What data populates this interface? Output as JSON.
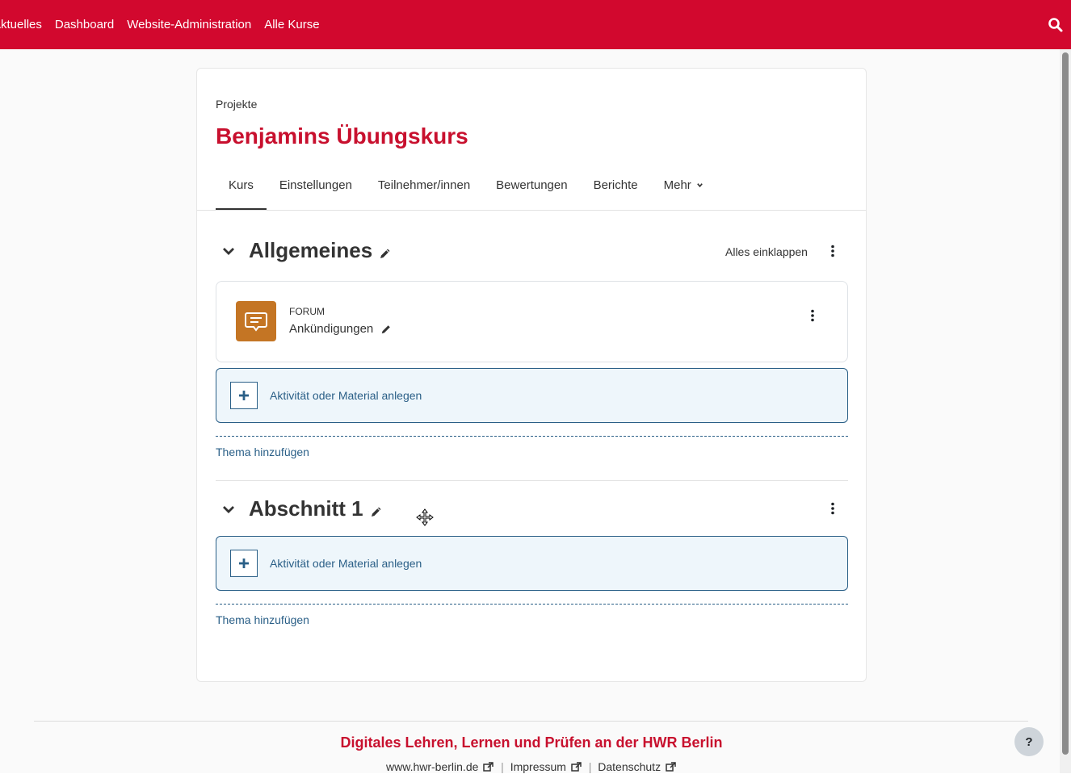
{
  "topnav": {
    "items": [
      "Aktuelles",
      "Dashboard",
      "Website-Administration",
      "Alle Kurse"
    ],
    "search_icon": "search-icon"
  },
  "course": {
    "breadcrumb": "Projekte",
    "title": "Benjamins Übungskurs",
    "tabs": [
      "Kurs",
      "Einstellungen",
      "Teilnehmer/innen",
      "Bewertungen",
      "Berichte",
      "Mehr"
    ],
    "active_tab": "Kurs"
  },
  "sections": [
    {
      "title": "Allgemeines",
      "collapse_all": "Alles einklappen",
      "activities": [
        {
          "type": "FORUM",
          "name": "Ankündigungen",
          "icon": "forum-icon"
        }
      ],
      "add_activity": "Aktivität oder Material anlegen",
      "add_topic": "Thema hinzufügen"
    },
    {
      "title": "Abschnitt 1",
      "add_activity": "Aktivität oder Material anlegen",
      "add_topic": "Thema hinzufügen"
    }
  ],
  "footer": {
    "title": "Digitales Lehren, Lernen und Prüfen an der HWR Berlin",
    "links": [
      "www.hwr-berlin.de",
      "Impressum",
      "Datenschutz"
    ],
    "help": "?"
  },
  "colors": {
    "brand_red": "#d2082e",
    "title_red": "#c8102e",
    "link_blue": "#2a5f87",
    "forum_orange": "#c47524"
  }
}
